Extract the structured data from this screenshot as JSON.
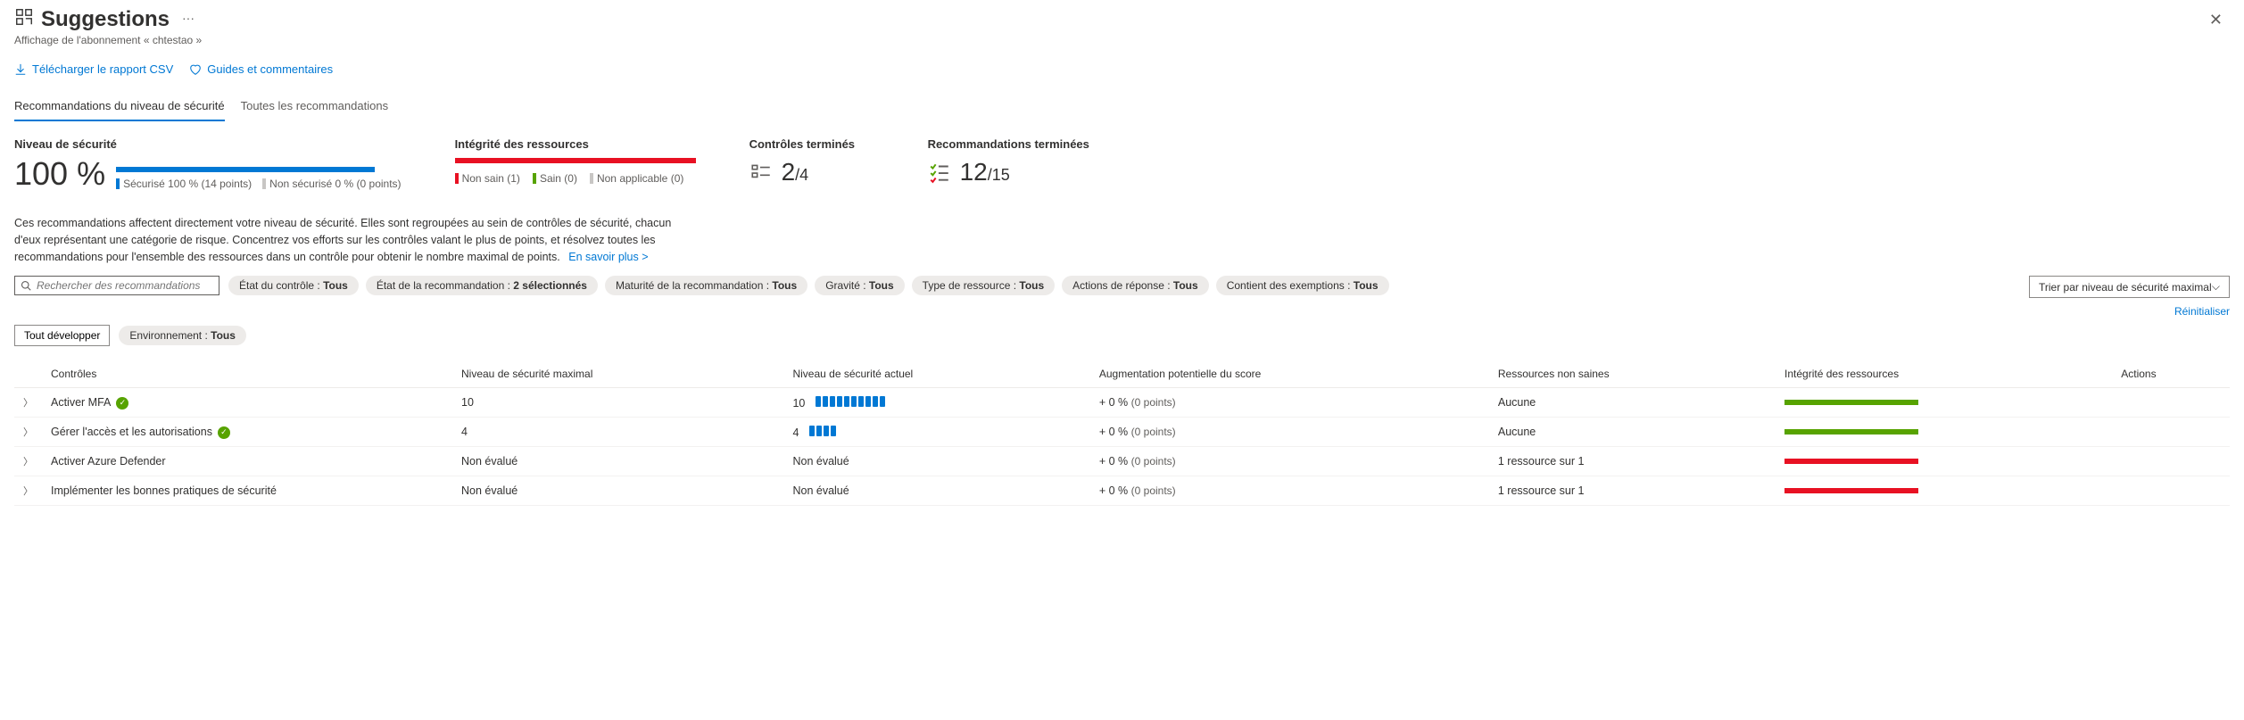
{
  "header": {
    "title": "Suggestions",
    "subtitle": "Affichage de l'abonnement « chtestao »"
  },
  "toolbar": {
    "download_csv": "Télécharger le rapport CSV",
    "feedback": "Guides et commentaires"
  },
  "tabs": {
    "active": "Recommandations du niveau de sécurité",
    "all": "Toutes les recommandations"
  },
  "stats": {
    "secure_score_title": "Niveau de sécurité",
    "secure_score_value": "100 %",
    "secure_legend_secured": "Sécurisé 100 % (14 points)",
    "secure_legend_unsecured": "Non sécurisé 0 % (0 points)",
    "health_title": "Intégrité des ressources",
    "health_unhealthy": "Non sain (1)",
    "health_healthy": "Sain (0)",
    "health_na": "Non applicable (0)",
    "controls_title": "Contrôles terminés",
    "controls_done": "2",
    "controls_total": "/4",
    "recs_title": "Recommandations terminées",
    "recs_done": "12",
    "recs_total": "/15"
  },
  "description": "Ces recommandations affectent directement votre niveau de sécurité. Elles sont regroupées au sein de contrôles de sécurité, chacun d'eux représentant une catégorie de risque. Concentrez vos efforts sur les contrôles valant le plus de points, et résolvez toutes les recommandations pour l'ensemble des ressources dans un contrôle pour obtenir le nombre maximal de points.",
  "learn_more": "En savoir plus >",
  "search_placeholder": "Rechercher des recommandations",
  "filters": {
    "control_state_label": "État du contrôle : ",
    "control_state_value": "Tous",
    "rec_state_label": "État de la recommandation : ",
    "rec_state_value": "2 sélectionnés",
    "maturity_label": "Maturité de la recommandation : ",
    "maturity_value": "Tous",
    "severity_label": "Gravité : ",
    "severity_value": "Tous",
    "resource_type_label": "Type de ressource : ",
    "resource_type_value": "Tous",
    "response_label": "Actions de réponse : ",
    "response_value": "Tous",
    "exemptions_label": "Contient des exemptions : ",
    "exemptions_value": "Tous",
    "env_label": "Environnement : ",
    "env_value": "Tous"
  },
  "expand_all": "Tout développer",
  "sort_label": "Trier par niveau de sécurité maximal",
  "reset": "Réinitialiser",
  "columns": {
    "controls": "Contrôles",
    "max": "Niveau de sécurité maximal",
    "current": "Niveau de sécurité actuel",
    "increase": "Augmentation potentielle du score",
    "unhealthy": "Ressources non saines",
    "health": "Intégrité des ressources",
    "actions": "Actions"
  },
  "rows": [
    {
      "name": "Activer MFA",
      "completed": true,
      "max": "10",
      "current": "10",
      "segments": 10,
      "increase_pct": "+ 0 %",
      "increase_pts": "(0 points)",
      "unhealthy": "Aucune",
      "health": "green"
    },
    {
      "name": "Gérer l'accès et les autorisations",
      "completed": true,
      "max": "4",
      "current": "4",
      "segments": 4,
      "increase_pct": "+ 0 %",
      "increase_pts": "(0 points)",
      "unhealthy": "Aucune",
      "health": "green"
    },
    {
      "name": "Activer Azure Defender",
      "completed": false,
      "max": "Non évalué",
      "current": "Non évalué",
      "segments": 0,
      "increase_pct": "+ 0 %",
      "increase_pts": "(0 points)",
      "unhealthy": "1 ressource sur 1",
      "health": "red"
    },
    {
      "name": "Implémenter les bonnes pratiques de sécurité",
      "completed": false,
      "max": "Non évalué",
      "current": "Non évalué",
      "segments": 0,
      "increase_pct": "+ 0 %",
      "increase_pts": "(0 points)",
      "unhealthy": "1 ressource sur 1",
      "health": "red"
    }
  ]
}
